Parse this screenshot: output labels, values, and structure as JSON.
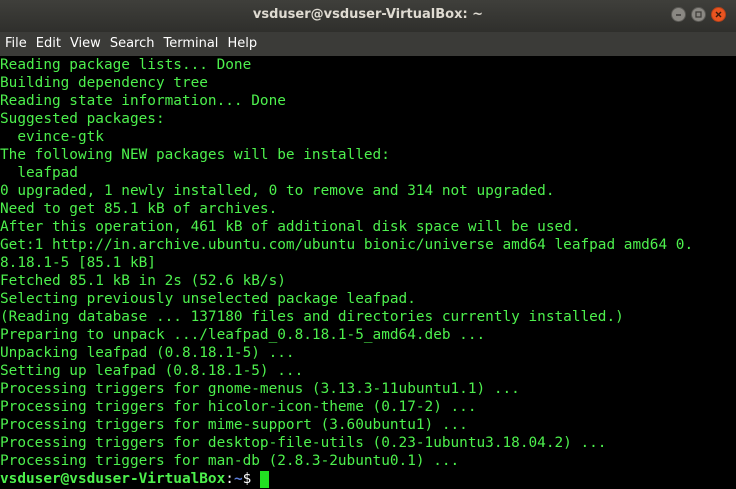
{
  "window": {
    "title": "vsduser@vsduser-VirtualBox: ~"
  },
  "menu": {
    "items": [
      "File",
      "Edit",
      "View",
      "Search",
      "Terminal",
      "Help"
    ]
  },
  "terminal": {
    "lines": [
      "Reading package lists... Done",
      "Building dependency tree",
      "Reading state information... Done",
      "Suggested packages:",
      "  evince-gtk",
      "The following NEW packages will be installed:",
      "  leafpad",
      "0 upgraded, 1 newly installed, 0 to remove and 314 not upgraded.",
      "Need to get 85.1 kB of archives.",
      "After this operation, 461 kB of additional disk space will be used.",
      "Get:1 http://in.archive.ubuntu.com/ubuntu bionic/universe amd64 leafpad amd64 0.",
      "8.18.1-5 [85.1 kB]",
      "Fetched 85.1 kB in 2s (52.6 kB/s)",
      "Selecting previously unselected package leafpad.",
      "(Reading database ... 137180 files and directories currently installed.)",
      "Preparing to unpack .../leafpad_0.8.18.1-5_amd64.deb ...",
      "Unpacking leafpad (0.8.18.1-5) ...",
      "Setting up leafpad (0.8.18.1-5) ...",
      "Processing triggers for gnome-menus (3.13.3-11ubuntu1.1) ...",
      "Processing triggers for hicolor-icon-theme (0.17-2) ...",
      "Processing triggers for mime-support (3.60ubuntu1) ...",
      "Processing triggers for desktop-file-utils (0.23-1ubuntu3.18.04.2) ...",
      "Processing triggers for man-db (2.8.3-2ubuntu0.1) ..."
    ],
    "prompt": {
      "user_host": "vsduser@vsduser-VirtualBox",
      "separator": ":",
      "path": "~",
      "symbol": "$"
    }
  },
  "colors": {
    "text_green": "#4df04d",
    "path_blue": "#5a7bd6",
    "close_orange": "#e95420",
    "background": "#000000"
  }
}
